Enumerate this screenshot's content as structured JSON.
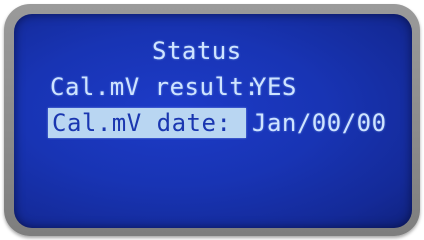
{
  "screen": {
    "title": "Status",
    "rows": [
      {
        "label": "Cal.mV result:",
        "value": "YES",
        "selected": false
      },
      {
        "label": "Cal.mV date:",
        "value": "Jan/00/00",
        "selected": true
      }
    ]
  },
  "colors": {
    "lcd_background": "#1834b4",
    "lcd_text": "#cfe4ff",
    "highlight": "#b9d6f2",
    "bezel": "#8a8a8a"
  }
}
